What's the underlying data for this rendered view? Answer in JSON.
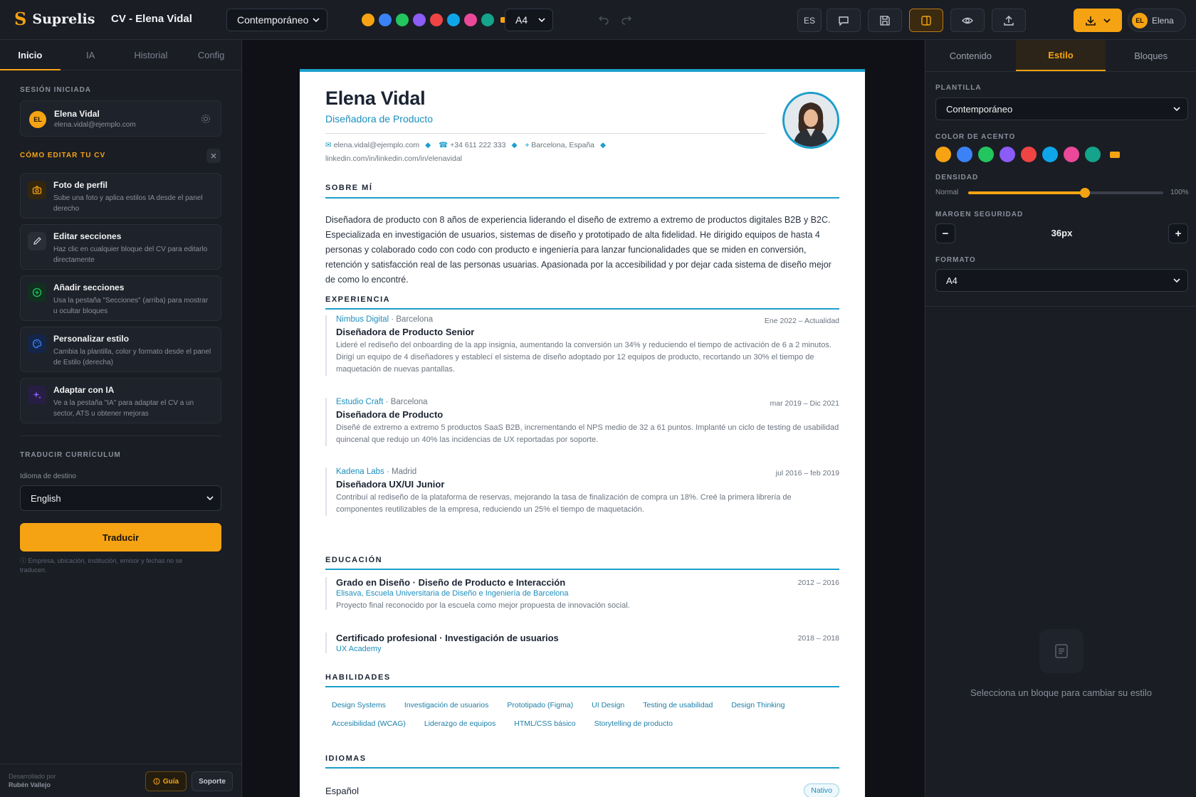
{
  "app": {
    "logo_glyph": "S",
    "name": "Suprelis",
    "doc_title": "CV - Elena Vidal",
    "template_select": "Contemporáneo",
    "page_size_select": "A4",
    "language_button": "ES",
    "user_initials": "EL",
    "user_name": "Elena",
    "accent_colors": [
      "#f5a312",
      "#3b82f6",
      "#22c55e",
      "#8b5cf6",
      "#ef4444",
      "#0ea5e9",
      "#ec4899",
      "#14a38b"
    ],
    "accent_custom": "#f5a312",
    "icons": [
      "undo-icon",
      "redo-icon",
      "comment-icon",
      "save-icon",
      "split-view-icon",
      "eye-icon",
      "upload-icon",
      "download-icon",
      "chevron-down-icon"
    ]
  },
  "left": {
    "tabs": [
      "Inicio",
      "IA",
      "Historial",
      "Config"
    ],
    "session_heading": "SESIÓN INICIADA",
    "session_initials": "EL",
    "session_name": "Elena Vidal",
    "session_email": "elena.vidal@ejemplo.com",
    "howto_heading": "CÓMO EDITAR TU CV",
    "tips": [
      {
        "title": "Foto de perfil",
        "desc": "Sube una foto y aplica estilos IA desde el panel derecho",
        "icon": "camera-icon",
        "color": "#f5a312",
        "bg": "#33260f"
      },
      {
        "title": "Editar secciones",
        "desc": "Haz clic en cualquier bloque del CV para editarlo directamente",
        "icon": "pencil-icon",
        "color": "#c8ccd4",
        "bg": "#2a2e37"
      },
      {
        "title": "Añadir secciones",
        "desc": "Usa la pestaña \"Secciones\" (arriba) para mostrar u ocultar bloques",
        "icon": "plus-circle-icon",
        "color": "#22c55e",
        "bg": "#12301f"
      },
      {
        "title": "Personalizar estilo",
        "desc": "Cambia la plantilla, color y formato desde el panel de Estilo (derecha)",
        "icon": "palette-icon",
        "color": "#3b82f6",
        "bg": "#13264a"
      },
      {
        "title": "Adaptar con IA",
        "desc": "Ve a la pestaña \"IA\" para adaptar el CV a un sector, ATS u obtener mejoras",
        "icon": "sparkle-icon",
        "color": "#8b5cf6",
        "bg": "#271e44"
      }
    ],
    "translate_heading": "TRADUCIR CURRÍCULUM",
    "target_language_label": "Idioma de destino",
    "target_language": "English",
    "translate_button": "Traducir",
    "translate_note": "Empresa, ubicación, institución, emisor y fechas no se traducen.",
    "developed_by_label": "Desarrollado por",
    "developer": "Rubén Vallejo",
    "guide_button": "Guía",
    "support_button": "Soporte"
  },
  "cv": {
    "name": "Elena Vidal",
    "role": "Diseñadora de Producto",
    "email": "elena.vidal@ejemplo.com",
    "phone": "+34 611 222 333",
    "location": "Barcelona, España",
    "linkedin": "linkedin.com/in/linkedin.com/in/elenavidal",
    "about_heading": "SOBRE MÍ",
    "about": "Diseñadora de producto con 8 años de experiencia liderando el diseño de extremo a extremo de productos digitales B2B y B2C. Especializada en investigación de usuarios, sistemas de diseño y prototipado de alta fidelidad. He dirigido equipos de hasta 4 personas y colaborado codo con codo con producto e ingeniería para lanzar funcionalidades que se miden en conversión, retención y satisfacción real de las personas usuarias. Apasionada por la accesibilidad y por dejar cada sistema de diseño mejor de como lo encontré.",
    "experience_heading": "EXPERIENCIA",
    "experience": [
      {
        "company": "Nimbus Digital",
        "location": "Barcelona",
        "dates": "Ene 2022 – Actualidad",
        "title": "Diseñadora de Producto Senior",
        "desc": "Lideré el rediseño del onboarding de la app insignia, aumentando la conversión un 34% y reduciendo el tiempo de activación de 6 a 2 minutos. Dirigí un equipo de 4 diseñadores y establecí el sistema de diseño adoptado por 12 equipos de producto, recortando un 30% el tiempo de maquetación de nuevas pantallas."
      },
      {
        "company": "Estudio Craft",
        "location": "Barcelona",
        "dates": "mar 2019 – Dic 2021",
        "title": "Diseñadora de Producto",
        "desc": "Diseñé de extremo a extremo 5 productos SaaS B2B, incrementando el NPS medio de 32 a 61 puntos. Implanté un ciclo de testing de usabilidad quincenal que redujo un 40% las incidencias de UX reportadas por soporte."
      },
      {
        "company": "Kadena Labs",
        "location": "Madrid",
        "dates": "jul 2016 – feb 2019",
        "title": "Diseñadora UX/UI Junior",
        "desc": "Contribuí al rediseño de la plataforma de reservas, mejorando la tasa de finalización de compra un 18%. Creé la primera librería de componentes reutilizables de la empresa, reduciendo un 25% el tiempo de maquetación."
      }
    ],
    "education_heading": "EDUCACIÓN",
    "education": [
      {
        "title": "Grado en Diseño · Diseño de Producto e Interacción",
        "institution": "Elisava, Escuela Universitaria de Diseño e Ingeniería de Barcelona",
        "dates": "2012 – 2016",
        "desc": "Proyecto final reconocido por la escuela como mejor propuesta de innovación social."
      },
      {
        "title": "Certificado profesional · Investigación de usuarios",
        "institution": "UX Academy",
        "dates": "2018 – 2018",
        "desc": ""
      }
    ],
    "skills_heading": "HABILIDADES",
    "skills": [
      "Design Systems",
      "Investigación de usuarios",
      "Prototipado (Figma)",
      "UI Design",
      "Testing de usabilidad",
      "Design Thinking",
      "Accesibilidad (WCAG)",
      "Liderazgo de equipos",
      "HTML/CSS básico",
      "Storytelling de producto"
    ],
    "languages_heading": "IDIOMAS",
    "languages": [
      {
        "name": "Español",
        "level": "Nativo"
      }
    ]
  },
  "right": {
    "tabs": [
      "Contenido",
      "Estilo",
      "Bloques"
    ],
    "template_label": "PLANTILLA",
    "template_value": "Contemporáneo",
    "accent_label": "COLOR DE ACENTO",
    "density_label": "DENSIDAD",
    "density_min": "Normal",
    "density_max": "100%",
    "density_position": 0.6,
    "margin_label": "MARGEN SEGURIDAD",
    "margin_value": "36px",
    "minus": "−",
    "plus": "+",
    "format_label": "FORMATO",
    "format_value": "A4",
    "empty_state": "Selecciona un bloque para cambiar su estilo"
  }
}
